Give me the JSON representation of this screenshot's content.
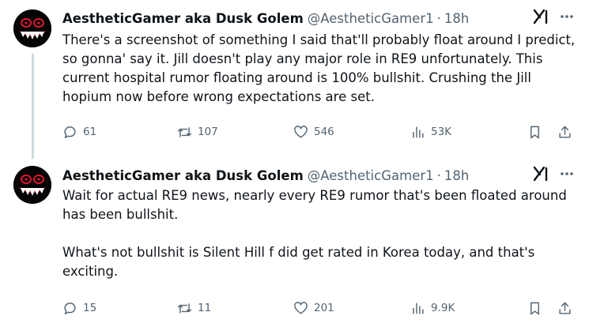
{
  "tweets": [
    {
      "author": {
        "name": "AestheticGamer aka Dusk Golem",
        "handle": "@AestheticGamer1"
      },
      "time": "18h",
      "paragraphs": [
        "There's a screenshot of something I said that'll probably float around I predict, so gonna' say it. Jill doesn't play any major role in RE9 unfortunately. This current hospital rumor floating around is 100% bullshit. Crushing the Jill hopium now before wrong expectations are set."
      ],
      "stats": {
        "replies": "61",
        "reposts": "107",
        "likes": "546",
        "views": "53K"
      }
    },
    {
      "author": {
        "name": "AestheticGamer aka Dusk Golem",
        "handle": "@AestheticGamer1"
      },
      "time": "18h",
      "paragraphs": [
        "Wait for actual RE9 news, nearly every RE9 rumor that's been floated around has been bullshit.",
        "What's not bullshit is Silent Hill f did get rated in Korea today, and that's exciting."
      ],
      "stats": {
        "replies": "15",
        "reposts": "11",
        "likes": "201",
        "views": "9.9K"
      }
    }
  ],
  "separator": "·",
  "icons": {
    "avatar": "demon-face-avatar",
    "grok": "grok-icon",
    "more": "more-icon",
    "reply": "reply-icon",
    "repost": "repost-icon",
    "like": "like-icon",
    "views": "views-icon",
    "bookmark": "bookmark-icon",
    "share": "share-icon"
  },
  "colors": {
    "text": "#0f1419",
    "secondary": "#536471",
    "thread_line": "#cfd9de",
    "avatar_accent": "#e0182d"
  }
}
